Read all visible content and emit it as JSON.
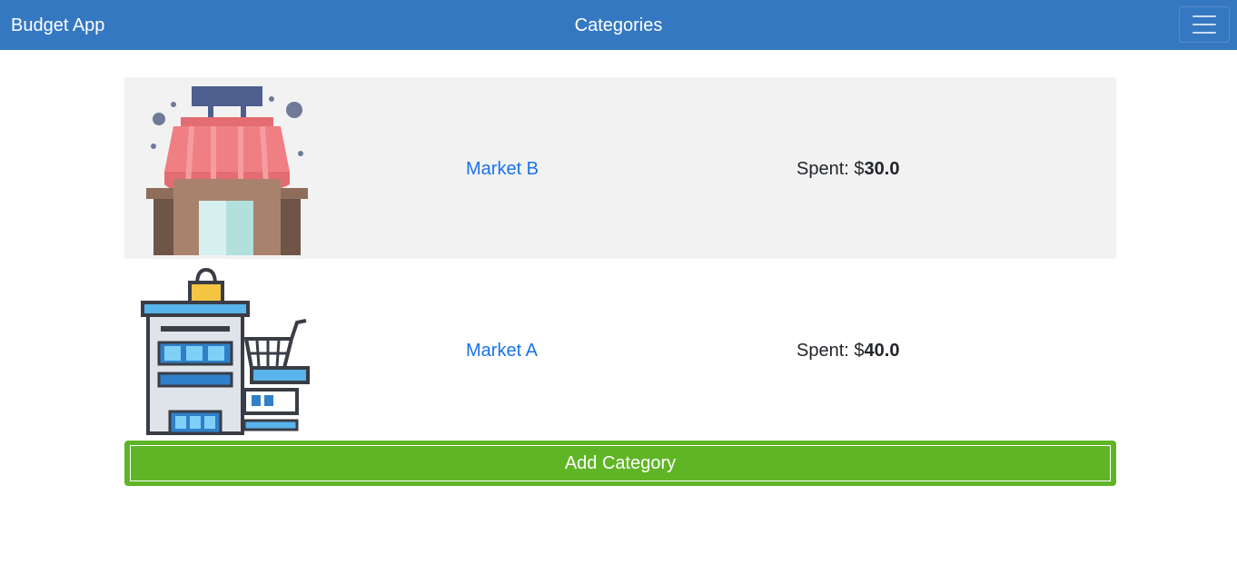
{
  "navbar": {
    "brand": "Budget App",
    "title": "Categories",
    "menu_icon": "hamburger-menu-icon",
    "color": "#3578c2"
  },
  "categories": [
    {
      "name": "Market B",
      "spent_label": "Spent: $",
      "spent_value": "30.0",
      "icon": "storefront-icon"
    },
    {
      "name": "Market A",
      "spent_label": "Spent: $",
      "spent_value": "40.0",
      "icon": "supermarket-cart-icon"
    }
  ],
  "actions": {
    "add_label": "Add Category",
    "add_color": "#5fb526"
  }
}
